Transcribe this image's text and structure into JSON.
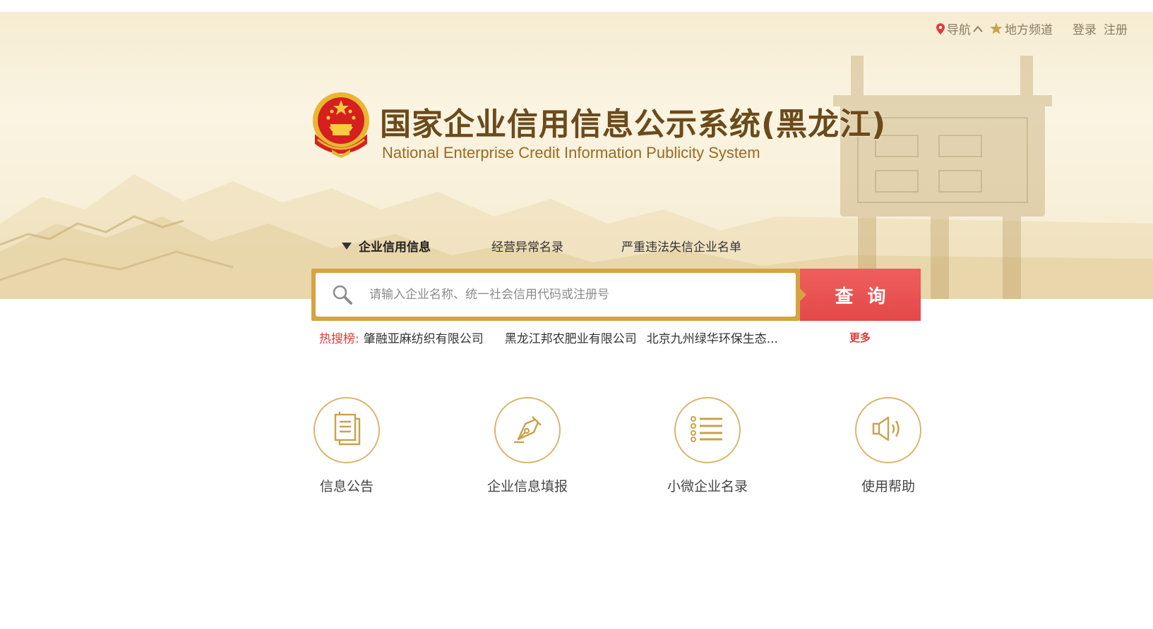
{
  "topbar": {
    "nav_label": "导航",
    "channel_label": "地方频道",
    "login_label": "登录",
    "register_label": "注册"
  },
  "header": {
    "title": "国家企业信用信息公示系统(黑龙江)",
    "subtitle": "National Enterprise Credit Information Publicity System"
  },
  "tabs": [
    {
      "label": "企业信用信息",
      "active": true
    },
    {
      "label": "经营异常名录",
      "active": false
    },
    {
      "label": "严重违法失信企业名单",
      "active": false
    }
  ],
  "search": {
    "placeholder": "请输入企业名称、统一社会信用代码或注册号",
    "button_label": "查询"
  },
  "hot": {
    "label": "热搜榜:",
    "items": [
      "肇融亚麻纺织有限公司",
      "黑龙江邦农肥业有限公司",
      "北京九州绿华环保生态..."
    ],
    "more_label": "更多"
  },
  "features": [
    {
      "label": "信息公告",
      "icon": "document-icon"
    },
    {
      "label": "企业信息填报",
      "icon": "pen-icon"
    },
    {
      "label": "小微企业名录",
      "icon": "list-icon"
    },
    {
      "label": "使用帮助",
      "icon": "speaker-icon"
    }
  ],
  "colors": {
    "accent_gold": "#d5a441",
    "button_red": "#e44848",
    "hot_red": "#e23a3a",
    "title_brown": "#6b4a1c"
  }
}
